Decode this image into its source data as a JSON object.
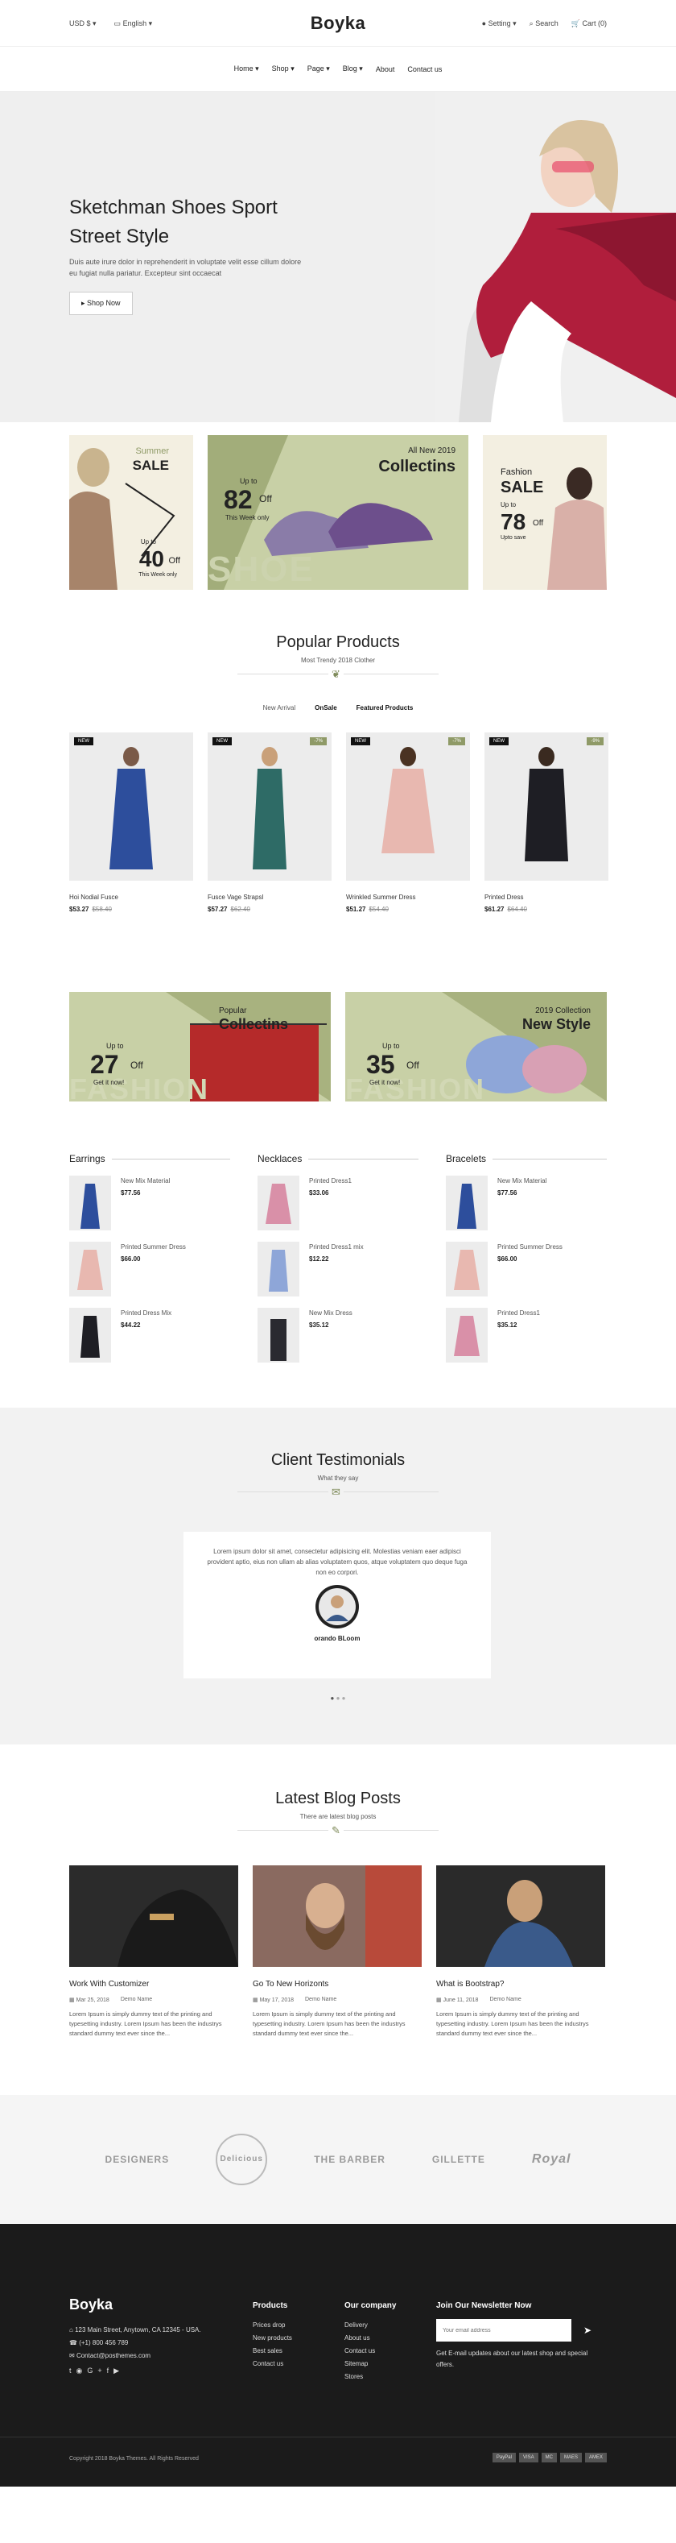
{
  "topbar": {
    "currency": "USD $",
    "language": "English",
    "logo": "Boyka",
    "setting": "Setting",
    "search": "Search",
    "cart": "Cart",
    "cart_count": "0"
  },
  "nav": [
    "Home",
    "Shop",
    "Page",
    "Blog",
    "About",
    "Contact us"
  ],
  "hero": {
    "title": "Sketchman Shoes Sport Street Style",
    "text": "Duis aute irure dolor in reprehenderit in voluptate velit esse cillum dolore eu fugiat nulla pariatur. Excepteur sint occaecat",
    "button": "Shop Now"
  },
  "banners": {
    "b1": {
      "title1": "Summer",
      "title2": "SALE",
      "up": "Up to",
      "pct": "40",
      "off": "Off",
      "week": "This Week only"
    },
    "b2": {
      "title1": "All New 2019",
      "title2": "Collectins",
      "up": "Up to",
      "pct": "82",
      "off": "Off",
      "week": "This Week only",
      "bg": "SHOE"
    },
    "b3": {
      "title1": "Fashion",
      "title2": "SALE",
      "up": "Up to",
      "pct": "78",
      "off": "Off",
      "week": "Upto save"
    }
  },
  "popular": {
    "title": "Popular Products",
    "subtitle": "Most Trendy 2018 Clother",
    "tabs": [
      "New Arrival",
      "OnSale",
      "Featured Products"
    ],
    "items": [
      {
        "name": "Hoi Nodial Fusce",
        "price": "$53.27",
        "old": "$58.40",
        "badge": "NEW",
        "sale": ""
      },
      {
        "name": "Fusce Vage Strapsl",
        "price": "$57.27",
        "old": "$62.40",
        "badge": "NEW",
        "sale": "-7%"
      },
      {
        "name": "Wrinkled Summer Dress",
        "price": "$51.27",
        "old": "$54.40",
        "badge": "NEW",
        "sale": "-7%"
      },
      {
        "name": "Printed Dress",
        "price": "$61.27",
        "old": "$64.40",
        "badge": "NEW",
        "sale": "-9%"
      }
    ]
  },
  "collections": [
    {
      "title1": "Popular",
      "title2": "Collectins",
      "up": "Up to",
      "pct": "27",
      "off": "Off",
      "cta": "Get it now!",
      "bg": "FASHION"
    },
    {
      "title1": "2019 Collection",
      "title2": "New Style",
      "up": "Up to",
      "pct": "35",
      "off": "Off",
      "cta": "Get it now!",
      "bg": "FASHION"
    }
  ],
  "lists": [
    {
      "title": "Earrings",
      "items": [
        {
          "name": "New Mix Material",
          "price": "$77.56"
        },
        {
          "name": "Printed Summer Dress",
          "price": "$66.00"
        },
        {
          "name": "Printed Dress Mix",
          "price": "$44.22"
        }
      ]
    },
    {
      "title": "Necklaces",
      "items": [
        {
          "name": "Printed Dress1",
          "price": "$33.06"
        },
        {
          "name": "Printed Dress1 mix",
          "price": "$12.22"
        },
        {
          "name": "New Mix Dress",
          "price": "$35.12"
        }
      ]
    },
    {
      "title": "Bracelets",
      "items": [
        {
          "name": "New Mix Material",
          "price": "$77.56"
        },
        {
          "name": "Printed Summer Dress",
          "price": "$66.00"
        },
        {
          "name": "Printed Dress1",
          "price": "$35.12"
        }
      ]
    }
  ],
  "testimonials": {
    "title": "Client Testimonials",
    "subtitle": "What they say",
    "quote": "Lorem ipsum dolor sit amet, consectetur adipisicing elit. Molestias veniam eaer adipisci provident aptio, eius non ullam ab alias voluptatem quos, atque voluptatem quo deque fuga non eo corpori.",
    "author": "orando BLoom"
  },
  "blog": {
    "title": "Latest Blog Posts",
    "subtitle": "There are latest blog posts",
    "posts": [
      {
        "title": "Work With Customizer",
        "date": "Mar 25, 2018",
        "author": "Demo Name",
        "excerpt": "Lorem Ipsum is simply dummy text of the printing and typesetting industry. Lorem Ipsum has been the industrys standard dummy text ever since the..."
      },
      {
        "title": "Go To New Horizonts",
        "date": "May 17, 2018",
        "author": "Demo Name",
        "excerpt": "Lorem Ipsum is simply dummy text of the printing and typesetting industry. Lorem Ipsum has been the industrys standard dummy text ever since the..."
      },
      {
        "title": "What is Bootstrap?",
        "date": "June 11, 2018",
        "author": "Demo Name",
        "excerpt": "Lorem Ipsum is simply dummy text of the printing and typesetting industry. Lorem Ipsum has been the industrys standard dummy text ever since the..."
      }
    ]
  },
  "brands": [
    "DESIGNERS",
    "Delicious",
    "THE BARBER",
    "GILLETTE",
    "Royal"
  ],
  "footer": {
    "logo": "Boyka",
    "address": "123 Main Street, Anytown, CA 12345 - USA.",
    "phone": "(+1) 800 456 789",
    "email": "Contact@posthemes.com",
    "products_title": "Products",
    "products": [
      "Prices drop",
      "New products",
      "Best sales",
      "Contact us"
    ],
    "company_title": "Our company",
    "company": [
      "Delivery",
      "About us",
      "Contact us",
      "Sitemap",
      "Stores"
    ],
    "newsletter_title": "Join Our Newsletter Now",
    "newsletter_placeholder": "Your email address",
    "newsletter_text": "Get E-mail updates about our latest shop and special offers.",
    "copyright": "Copyright 2018 Boyka Themes. All Rights Reserved",
    "payments": [
      "PayPal",
      "VISA",
      "MC",
      "MAES",
      "AMEX"
    ]
  }
}
